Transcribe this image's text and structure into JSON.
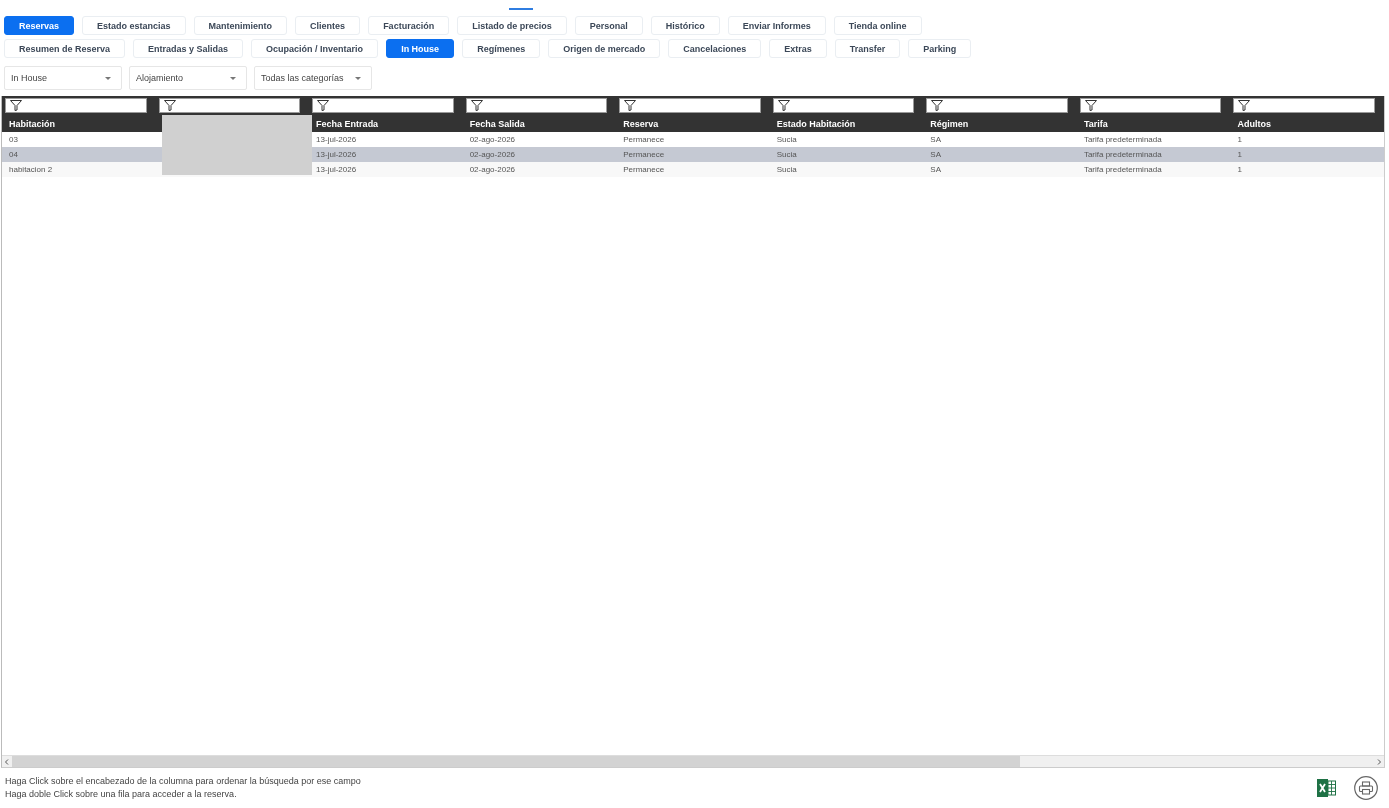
{
  "main_tabs": [
    {
      "label": "Reservas",
      "selected": true
    },
    {
      "label": "Estado estancias",
      "selected": false
    },
    {
      "label": "Mantenimiento",
      "selected": false
    },
    {
      "label": "Clientes",
      "selected": false
    },
    {
      "label": "Facturación",
      "selected": false
    },
    {
      "label": "Listado de precios",
      "selected": false
    },
    {
      "label": "Personal",
      "selected": false
    },
    {
      "label": "Histórico",
      "selected": false
    },
    {
      "label": "Enviar Informes",
      "selected": false
    },
    {
      "label": "Tienda online",
      "selected": false
    }
  ],
  "sub_tabs": [
    {
      "label": "Resumen de Reserva",
      "selected": false
    },
    {
      "label": "Entradas y Salidas",
      "selected": false
    },
    {
      "label": "Ocupación / Inventario",
      "selected": false
    },
    {
      "label": "In House",
      "selected": true
    },
    {
      "label": "Regímenes",
      "selected": false
    },
    {
      "label": "Origen de mercado",
      "selected": false
    },
    {
      "label": "Cancelaciones",
      "selected": false
    },
    {
      "label": "Extras",
      "selected": false
    },
    {
      "label": "Transfer",
      "selected": false
    },
    {
      "label": "Parking",
      "selected": false
    }
  ],
  "dropdowns": [
    {
      "value": "In House"
    },
    {
      "value": "Alojamiento"
    },
    {
      "value": "Todas las categorías"
    }
  ],
  "table": {
    "columns": [
      {
        "label": "Habitación",
        "hidden": false
      },
      {
        "hidden": true
      },
      {
        "label": "Fecha Entrada",
        "hidden": false
      },
      {
        "label": "Fecha Salida",
        "hidden": false
      },
      {
        "label": "Reserva",
        "hidden": false
      },
      {
        "label": "Estado Habitación",
        "hidden": false
      },
      {
        "label": "Régimen",
        "hidden": false
      },
      {
        "label": "Tarifa",
        "hidden": false
      },
      {
        "label": "Adultos",
        "hidden": false
      }
    ],
    "rows": [
      {
        "selected": false,
        "cells": [
          "03",
          "",
          "13-jul-2026",
          "02-ago-2026",
          "Permanece",
          "Sucia",
          "SA",
          "Tarifa predeterminada",
          "1"
        ]
      },
      {
        "selected": true,
        "cells": [
          "04",
          "",
          "13-jul-2026",
          "02-ago-2026",
          "Permanece",
          "Sucia",
          "SA",
          "Tarifa predeterminada",
          "1"
        ]
      },
      {
        "selected": false,
        "cells": [
          "habitacion 2",
          "",
          "13-jul-2026",
          "02-ago-2026",
          "Permanece",
          "Sucia",
          "SA",
          "Tarifa predeterminada",
          "1"
        ]
      }
    ]
  },
  "footer": {
    "hints": [
      "Haga Click sobre el encabezado de la columna para ordenar la búsqueda por ese campo",
      "Haga doble Click sobre una fila para acceder a la reserva."
    ]
  }
}
